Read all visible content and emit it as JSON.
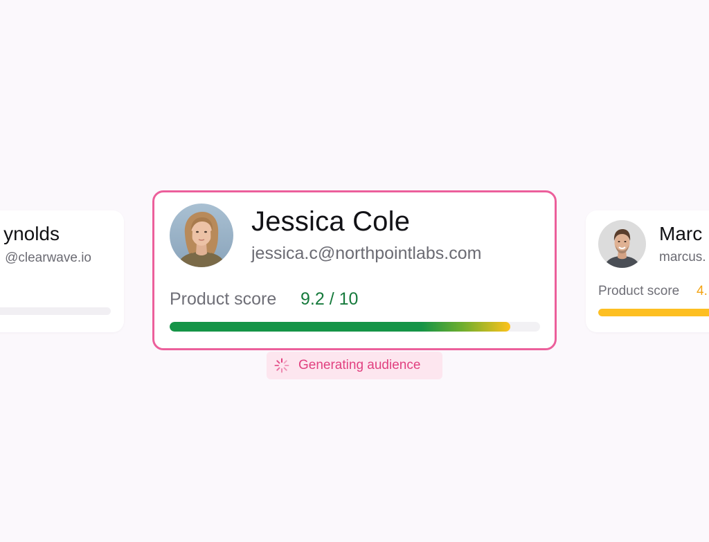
{
  "colors": {
    "accent_pink": "#ec5f9b",
    "score_high": "#167a3c",
    "score_mid": "#f3a313",
    "page_background": "#fbf8fc"
  },
  "cards": {
    "left": {
      "name": "ynolds",
      "email": "@clearwave.io"
    },
    "center": {
      "name": "Jessica Cole",
      "email": "jessica.c@northpointlabs.com",
      "score_label": "Product score",
      "score_value": "9.2 / 10",
      "score_fraction": 0.92,
      "avatar_icon": "woman-portrait-avatar"
    },
    "right": {
      "name": "Marc",
      "email": "marcus.",
      "score_label": "Product score",
      "score_value": "4.",
      "avatar_icon": "man-portrait-avatar"
    }
  },
  "status": {
    "label": "Generating audience",
    "icon": "loading-spinner-icon"
  }
}
